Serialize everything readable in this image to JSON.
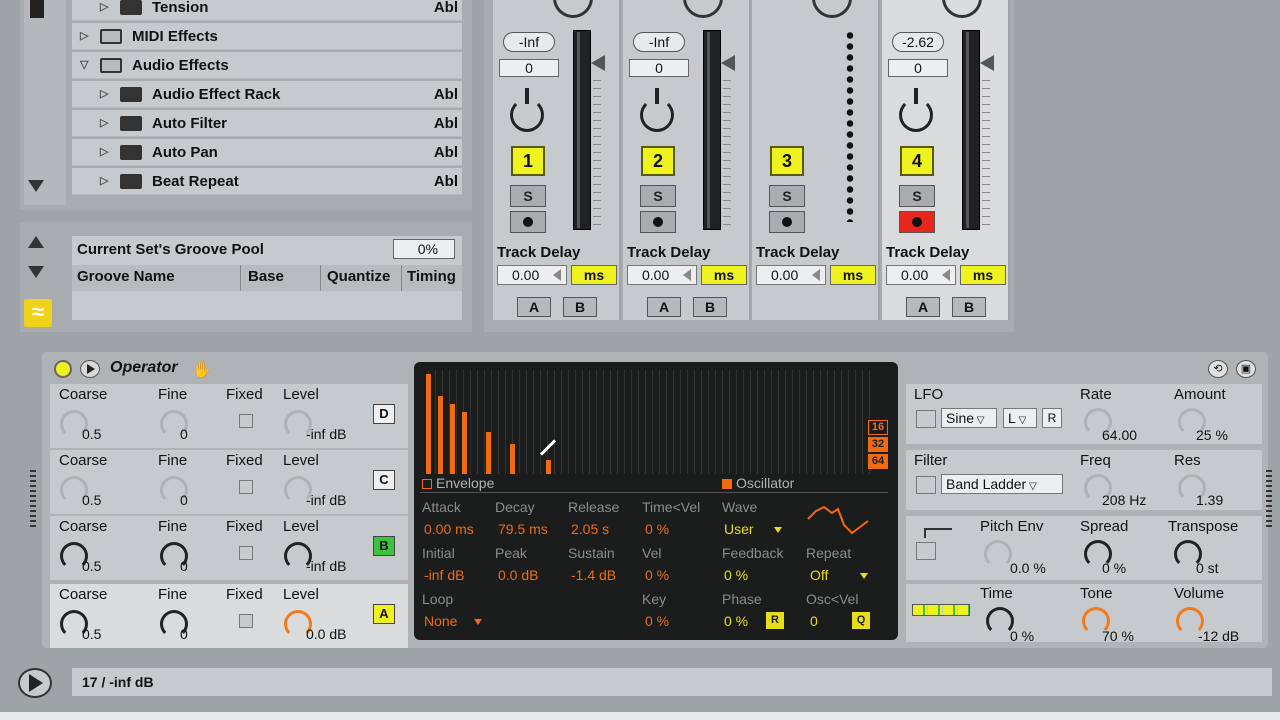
{
  "browser": {
    "items": [
      {
        "label": "Tension",
        "indent": 1,
        "type": "device",
        "suffix": "Abl"
      },
      {
        "label": "MIDI Effects",
        "indent": 0,
        "type": "folder",
        "suffix": ""
      },
      {
        "label": "Audio Effects",
        "indent": 0,
        "type": "folder-open",
        "suffix": ""
      },
      {
        "label": "Audio Effect Rack",
        "indent": 1,
        "type": "device",
        "suffix": "Abl"
      },
      {
        "label": "Auto Filter",
        "indent": 1,
        "type": "device",
        "suffix": "Abl"
      },
      {
        "label": "Auto Pan",
        "indent": 1,
        "type": "device",
        "suffix": "Abl"
      },
      {
        "label": "Beat Repeat",
        "indent": 1,
        "type": "device",
        "suffix": "Abl"
      }
    ]
  },
  "groove_pool": {
    "title": "Current Set's Groove Pool",
    "percent": "0%",
    "columns": [
      "Groove Name",
      "Base",
      "Quantize",
      "Timing"
    ]
  },
  "mixer": {
    "tracks": [
      {
        "volume": "-Inf",
        "pan": "0",
        "number": "1",
        "solo": "S",
        "arm_active": false,
        "delay_label": "Track Delay",
        "delay": "0.00",
        "unit": "ms",
        "a": "A",
        "b": "B"
      },
      {
        "volume": "-Inf",
        "pan": "0",
        "number": "2",
        "solo": "S",
        "arm_active": false,
        "delay_label": "Track Delay",
        "delay": "0.00",
        "unit": "ms",
        "a": "A",
        "b": "B"
      },
      {
        "volume": "",
        "pan": "",
        "number": "3",
        "solo": "S",
        "arm_active": false,
        "delay_label": "Track Delay",
        "delay": "0.00",
        "unit": "ms",
        "a": "",
        "b": ""
      },
      {
        "volume": "-2.62",
        "pan": "0",
        "number": "4",
        "solo": "S",
        "arm_active": true,
        "delay_label": "Track Delay",
        "delay": "0.00",
        "unit": "ms",
        "a": "A",
        "b": "B"
      }
    ]
  },
  "operator": {
    "title": "Operator",
    "oscillators": [
      {
        "coarse_label": "Coarse",
        "coarse": "0.5",
        "fine_label": "Fine",
        "fine": "0",
        "fixed_label": "Fixed",
        "level_label": "Level",
        "level": "-inf dB",
        "letter": "D",
        "active": false
      },
      {
        "coarse_label": "Coarse",
        "coarse": "0.5",
        "fine_label": "Fine",
        "fine": "0",
        "fixed_label": "Fixed",
        "level_label": "Level",
        "level": "-inf dB",
        "letter": "C",
        "active": false
      },
      {
        "coarse_label": "Coarse",
        "coarse": "0.5",
        "fine_label": "Fine",
        "fine": "0",
        "fixed_label": "Fixed",
        "level_label": "Level",
        "level": "-inf dB",
        "letter": "B",
        "active": true
      },
      {
        "coarse_label": "Coarse",
        "coarse": "0.5",
        "fine_label": "Fine",
        "fine": "0",
        "fixed_label": "Fixed",
        "level_label": "Level",
        "level": "0.0 dB",
        "letter": "A",
        "active": false
      }
    ],
    "display": {
      "harmonic_sizes": [
        "16",
        "32",
        "64"
      ],
      "envelope_label": "Envelope",
      "oscillator_label": "Oscillator",
      "attack_label": "Attack",
      "attack": "0.00 ms",
      "decay_label": "Decay",
      "decay": "79.5 ms",
      "release_label": "Release",
      "release": "2.05 s",
      "timevel_label": "Time<Vel",
      "timevel": "0 %",
      "initial_label": "Initial",
      "initial": "-inf dB",
      "peak_label": "Peak",
      "peak": "0.0 dB",
      "sustain_label": "Sustain",
      "sustain": "-1.4 dB",
      "vel_label": "Vel",
      "vel": "0 %",
      "loop_label": "Loop",
      "loop": "None",
      "key_label": "Key",
      "key": "0 %",
      "wave_label": "Wave",
      "wave": "User",
      "feedback_label": "Feedback",
      "feedback": "0 %",
      "repeat_label": "Repeat",
      "repeat": "Off",
      "phase_label": "Phase",
      "phase": "0 %",
      "phase_btn": "R",
      "oscvel_label": "Osc<Vel",
      "oscvel": "0",
      "oscvel_btn": "Q"
    },
    "lfo": {
      "label": "LFO",
      "wave": "Sine",
      "range": "L",
      "retrig": "R",
      "rate_label": "Rate",
      "rate": "64.00",
      "amount_label": "Amount",
      "amount": "25 %"
    },
    "filter": {
      "label": "Filter",
      "type": "Band Ladder",
      "freq_label": "Freq",
      "freq": "208 Hz",
      "res_label": "Res",
      "res": "1.39"
    },
    "pitch": {
      "label": "Pitch Env",
      "value": "0.0 %",
      "spread_label": "Spread",
      "spread": "0 %",
      "transpose_label": "Transpose",
      "transpose": "0 st"
    },
    "global": {
      "time_label": "Time",
      "time": "0 %",
      "tone_label": "Tone",
      "tone": "70 %",
      "volume_label": "Volume",
      "volume": "-12 dB"
    }
  },
  "status": {
    "text": "17 / -inf dB"
  },
  "colors": {
    "accent_yellow": "#eef21e",
    "accent_orange": "#f07b1a",
    "arm_red": "#e8261e"
  }
}
